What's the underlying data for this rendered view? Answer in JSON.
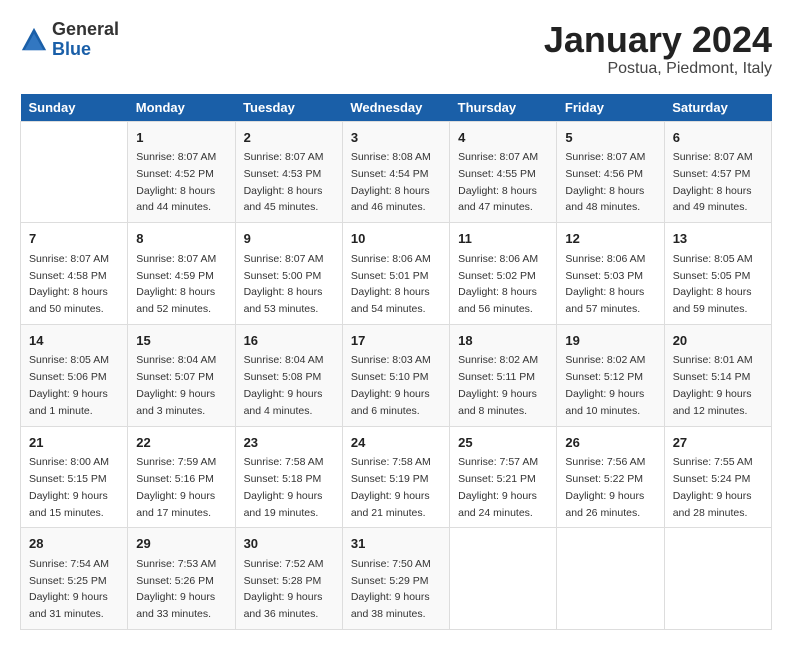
{
  "header": {
    "logo": {
      "general": "General",
      "blue": "Blue"
    },
    "title": "January 2024",
    "subtitle": "Postua, Piedmont, Italy"
  },
  "calendar": {
    "weekdays": [
      "Sunday",
      "Monday",
      "Tuesday",
      "Wednesday",
      "Thursday",
      "Friday",
      "Saturday"
    ],
    "weeks": [
      [
        {
          "day": "",
          "sunrise": "",
          "sunset": "",
          "daylight": ""
        },
        {
          "day": "1",
          "sunrise": "Sunrise: 8:07 AM",
          "sunset": "Sunset: 4:52 PM",
          "daylight": "Daylight: 8 hours and 44 minutes."
        },
        {
          "day": "2",
          "sunrise": "Sunrise: 8:07 AM",
          "sunset": "Sunset: 4:53 PM",
          "daylight": "Daylight: 8 hours and 45 minutes."
        },
        {
          "day": "3",
          "sunrise": "Sunrise: 8:08 AM",
          "sunset": "Sunset: 4:54 PM",
          "daylight": "Daylight: 8 hours and 46 minutes."
        },
        {
          "day": "4",
          "sunrise": "Sunrise: 8:07 AM",
          "sunset": "Sunset: 4:55 PM",
          "daylight": "Daylight: 8 hours and 47 minutes."
        },
        {
          "day": "5",
          "sunrise": "Sunrise: 8:07 AM",
          "sunset": "Sunset: 4:56 PM",
          "daylight": "Daylight: 8 hours and 48 minutes."
        },
        {
          "day": "6",
          "sunrise": "Sunrise: 8:07 AM",
          "sunset": "Sunset: 4:57 PM",
          "daylight": "Daylight: 8 hours and 49 minutes."
        }
      ],
      [
        {
          "day": "7",
          "sunrise": "Sunrise: 8:07 AM",
          "sunset": "Sunset: 4:58 PM",
          "daylight": "Daylight: 8 hours and 50 minutes."
        },
        {
          "day": "8",
          "sunrise": "Sunrise: 8:07 AM",
          "sunset": "Sunset: 4:59 PM",
          "daylight": "Daylight: 8 hours and 52 minutes."
        },
        {
          "day": "9",
          "sunrise": "Sunrise: 8:07 AM",
          "sunset": "Sunset: 5:00 PM",
          "daylight": "Daylight: 8 hours and 53 minutes."
        },
        {
          "day": "10",
          "sunrise": "Sunrise: 8:06 AM",
          "sunset": "Sunset: 5:01 PM",
          "daylight": "Daylight: 8 hours and 54 minutes."
        },
        {
          "day": "11",
          "sunrise": "Sunrise: 8:06 AM",
          "sunset": "Sunset: 5:02 PM",
          "daylight": "Daylight: 8 hours and 56 minutes."
        },
        {
          "day": "12",
          "sunrise": "Sunrise: 8:06 AM",
          "sunset": "Sunset: 5:03 PM",
          "daylight": "Daylight: 8 hours and 57 minutes."
        },
        {
          "day": "13",
          "sunrise": "Sunrise: 8:05 AM",
          "sunset": "Sunset: 5:05 PM",
          "daylight": "Daylight: 8 hours and 59 minutes."
        }
      ],
      [
        {
          "day": "14",
          "sunrise": "Sunrise: 8:05 AM",
          "sunset": "Sunset: 5:06 PM",
          "daylight": "Daylight: 9 hours and 1 minute."
        },
        {
          "day": "15",
          "sunrise": "Sunrise: 8:04 AM",
          "sunset": "Sunset: 5:07 PM",
          "daylight": "Daylight: 9 hours and 3 minutes."
        },
        {
          "day": "16",
          "sunrise": "Sunrise: 8:04 AM",
          "sunset": "Sunset: 5:08 PM",
          "daylight": "Daylight: 9 hours and 4 minutes."
        },
        {
          "day": "17",
          "sunrise": "Sunrise: 8:03 AM",
          "sunset": "Sunset: 5:10 PM",
          "daylight": "Daylight: 9 hours and 6 minutes."
        },
        {
          "day": "18",
          "sunrise": "Sunrise: 8:02 AM",
          "sunset": "Sunset: 5:11 PM",
          "daylight": "Daylight: 9 hours and 8 minutes."
        },
        {
          "day": "19",
          "sunrise": "Sunrise: 8:02 AM",
          "sunset": "Sunset: 5:12 PM",
          "daylight": "Daylight: 9 hours and 10 minutes."
        },
        {
          "day": "20",
          "sunrise": "Sunrise: 8:01 AM",
          "sunset": "Sunset: 5:14 PM",
          "daylight": "Daylight: 9 hours and 12 minutes."
        }
      ],
      [
        {
          "day": "21",
          "sunrise": "Sunrise: 8:00 AM",
          "sunset": "Sunset: 5:15 PM",
          "daylight": "Daylight: 9 hours and 15 minutes."
        },
        {
          "day": "22",
          "sunrise": "Sunrise: 7:59 AM",
          "sunset": "Sunset: 5:16 PM",
          "daylight": "Daylight: 9 hours and 17 minutes."
        },
        {
          "day": "23",
          "sunrise": "Sunrise: 7:58 AM",
          "sunset": "Sunset: 5:18 PM",
          "daylight": "Daylight: 9 hours and 19 minutes."
        },
        {
          "day": "24",
          "sunrise": "Sunrise: 7:58 AM",
          "sunset": "Sunset: 5:19 PM",
          "daylight": "Daylight: 9 hours and 21 minutes."
        },
        {
          "day": "25",
          "sunrise": "Sunrise: 7:57 AM",
          "sunset": "Sunset: 5:21 PM",
          "daylight": "Daylight: 9 hours and 24 minutes."
        },
        {
          "day": "26",
          "sunrise": "Sunrise: 7:56 AM",
          "sunset": "Sunset: 5:22 PM",
          "daylight": "Daylight: 9 hours and 26 minutes."
        },
        {
          "day": "27",
          "sunrise": "Sunrise: 7:55 AM",
          "sunset": "Sunset: 5:24 PM",
          "daylight": "Daylight: 9 hours and 28 minutes."
        }
      ],
      [
        {
          "day": "28",
          "sunrise": "Sunrise: 7:54 AM",
          "sunset": "Sunset: 5:25 PM",
          "daylight": "Daylight: 9 hours and 31 minutes."
        },
        {
          "day": "29",
          "sunrise": "Sunrise: 7:53 AM",
          "sunset": "Sunset: 5:26 PM",
          "daylight": "Daylight: 9 hours and 33 minutes."
        },
        {
          "day": "30",
          "sunrise": "Sunrise: 7:52 AM",
          "sunset": "Sunset: 5:28 PM",
          "daylight": "Daylight: 9 hours and 36 minutes."
        },
        {
          "day": "31",
          "sunrise": "Sunrise: 7:50 AM",
          "sunset": "Sunset: 5:29 PM",
          "daylight": "Daylight: 9 hours and 38 minutes."
        },
        {
          "day": "",
          "sunrise": "",
          "sunset": "",
          "daylight": ""
        },
        {
          "day": "",
          "sunrise": "",
          "sunset": "",
          "daylight": ""
        },
        {
          "day": "",
          "sunrise": "",
          "sunset": "",
          "daylight": ""
        }
      ]
    ]
  }
}
